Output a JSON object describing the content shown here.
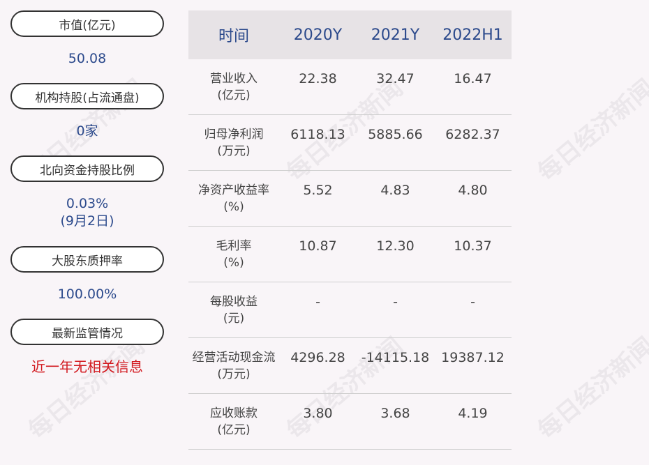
{
  "left": [
    {
      "label": "市值(亿元)",
      "value": "50.08"
    },
    {
      "label": "机构持股(占流通盘)",
      "value": "0家"
    },
    {
      "label": "北向资金持股比例",
      "value": "0.03%",
      "value2": "(9月2日)"
    },
    {
      "label": "大股东质押率",
      "value": "100.00%"
    },
    {
      "label": "最新监管情况",
      "value": "近一年无相关信息"
    }
  ],
  "table": {
    "headers": [
      "时间",
      "2020Y",
      "2021Y",
      "2022H1"
    ],
    "rows": [
      {
        "label1": "营业收入",
        "label2": "(亿元)",
        "values": [
          "22.38",
          "32.47",
          "16.47"
        ]
      },
      {
        "label1": "归母净利润",
        "label2": "(万元)",
        "values": [
          "6118.13",
          "5885.66",
          "6282.37"
        ]
      },
      {
        "label1": "净资产收益率",
        "label2": "(%)",
        "values": [
          "5.52",
          "4.83",
          "4.80"
        ]
      },
      {
        "label1": "毛利率",
        "label2": "(%)",
        "values": [
          "10.87",
          "12.30",
          "10.37"
        ]
      },
      {
        "label1": "每股收益",
        "label2": "(元)",
        "values": [
          "-",
          "-",
          "-"
        ]
      },
      {
        "label1": "经营活动现金流",
        "label2": "(万元)",
        "values": [
          "4296.28",
          "-14115.18",
          "19387.12"
        ]
      },
      {
        "label1": "应收账款",
        "label2": "(亿元)",
        "values": [
          "3.80",
          "3.68",
          "4.19"
        ]
      }
    ]
  },
  "watermark": "每日经济新闻",
  "colors": {
    "value_blue": "#2c4a8c",
    "alert_red": "#d2191f",
    "header_bg": "#e7e3e6"
  }
}
